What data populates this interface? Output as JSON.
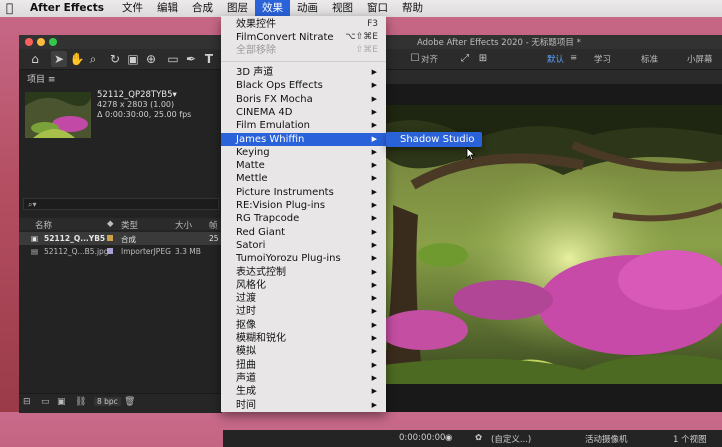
{
  "menubar": {
    "app": "After Effects",
    "items": [
      "文件",
      "编辑",
      "合成",
      "图层",
      "效果",
      "动画",
      "视图",
      "窗口",
      "帮助"
    ],
    "active": "效果"
  },
  "window": {
    "title": "Adobe After Effects 2020 - 无标题项目 *"
  },
  "toolbar": {
    "align_label": "对齐",
    "workspaces": [
      "默认",
      "学习",
      "标准",
      "小屏幕"
    ],
    "active_workspace": "默认"
  },
  "project": {
    "tab_label": "项目",
    "item_name": "52112_QP28TYB5▾",
    "item_dims": "4278 x 2803 (1.00)",
    "item_duration": "Δ 0:00:30:00, 25.00 fps",
    "search_placeholder": "⌕▾",
    "columns": [
      "名称",
      "类型",
      "大小",
      "帧"
    ],
    "rows": [
      {
        "name": "52112_Q...YB5",
        "type": "合成",
        "size": "",
        "fps": "25",
        "swatch": "#c9a24a"
      },
      {
        "name": "52112_Q...B5.jpg",
        "type": "ImporterJPEG",
        "size": "3.3 MB",
        "fps": "",
        "swatch": "#a9a1d6"
      }
    ],
    "bpc": "8 bpc"
  },
  "viewer": {
    "timecode": "0:00:00:00",
    "view_mode": "(自定义...)",
    "camera": "活动摄像机",
    "views": "1 个视图"
  },
  "effects_menu": {
    "group1": [
      {
        "label": "效果控件",
        "shortcut": "F3",
        "disabled": false
      },
      {
        "label": "FilmConvert Nitrate",
        "shortcut": "⌥⇧⌘E",
        "disabled": false
      },
      {
        "label": "全部移除",
        "shortcut": "⇧⌘E",
        "disabled": true
      }
    ],
    "group2": [
      "3D 声道",
      "Black Ops Effects",
      "Boris FX Mocha",
      "CINEMA 4D",
      "Film Emulation",
      "James Whiffin",
      "Keying",
      "Matte",
      "Mettle",
      "Picture Instruments",
      "RE:Vision Plug-ins",
      "RG Trapcode",
      "Red Giant",
      "Satori",
      "TumoiYorozu Plug-ins",
      "表达式控制",
      "风格化",
      "过渡",
      "过时",
      "抠像",
      "模糊和锐化",
      "模拟",
      "扭曲",
      "声道",
      "生成",
      "时间"
    ],
    "highlighted": "James Whiffin",
    "submenu_item": "Shadow Studio"
  }
}
